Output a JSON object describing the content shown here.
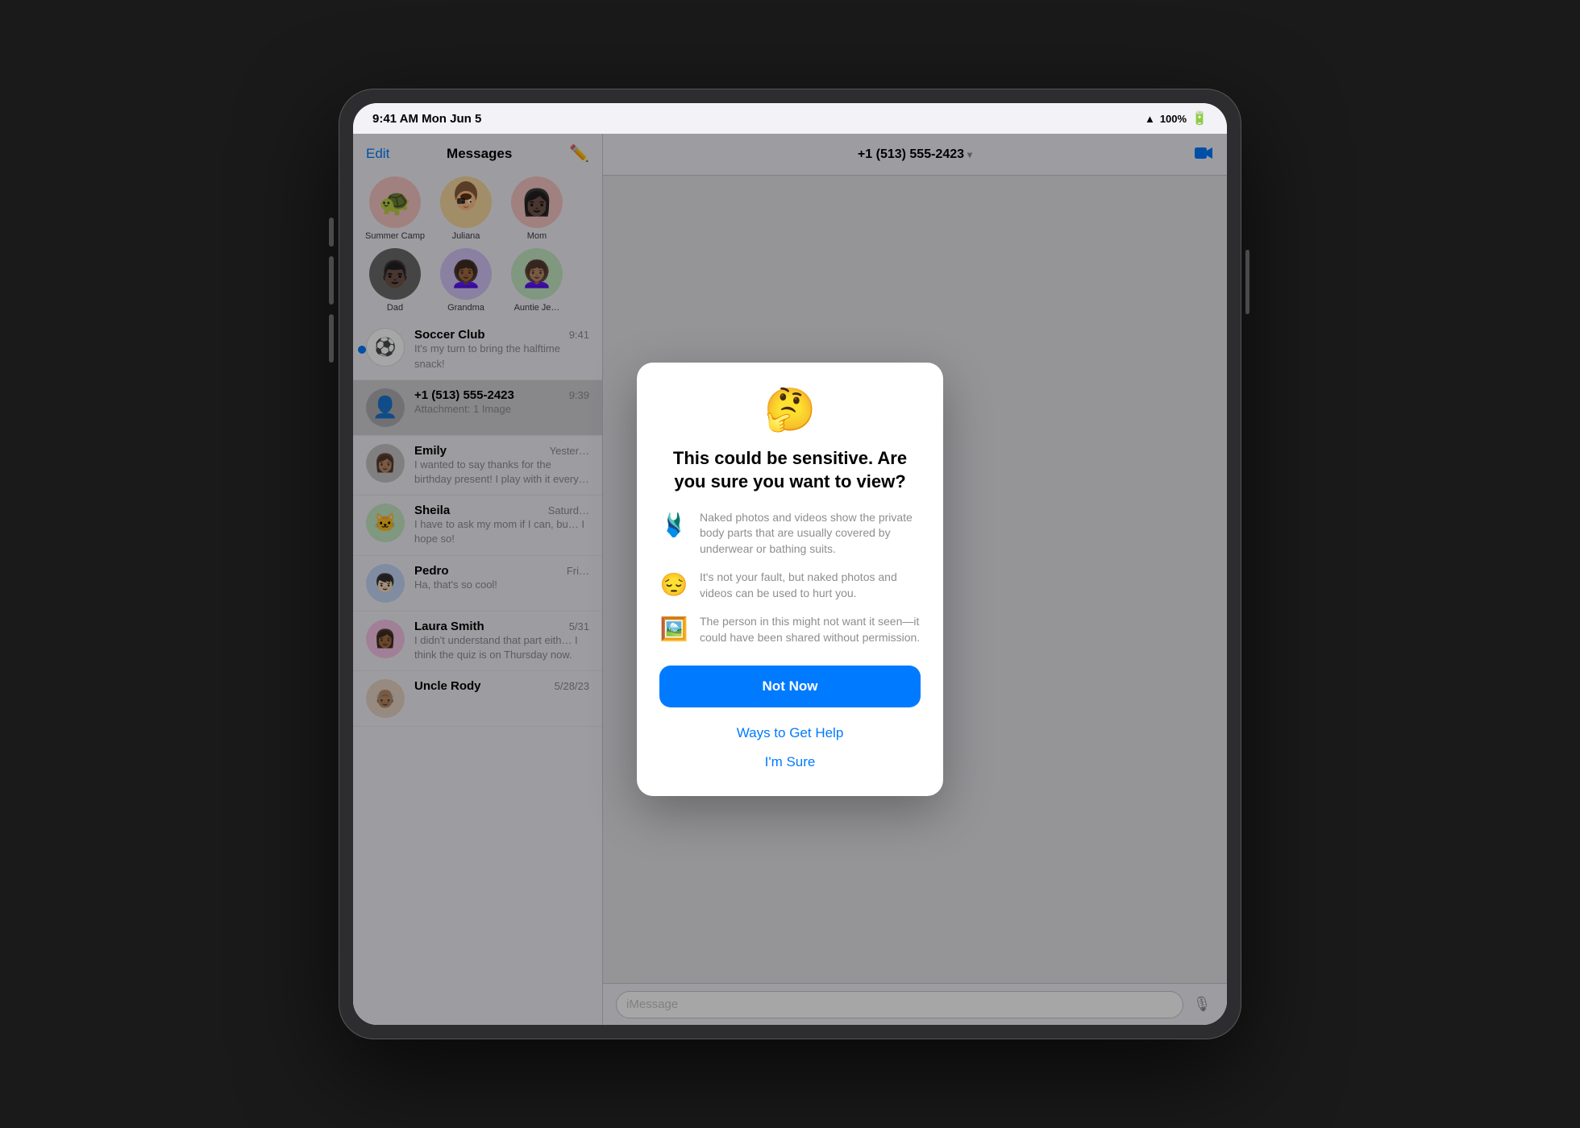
{
  "statusBar": {
    "time": "9:41 AM  Mon Jun 5",
    "wifi": "WiFi",
    "battery": "100%"
  },
  "sidebar": {
    "editLabel": "Edit",
    "title": "Messages"
  },
  "pinnedContacts": [
    {
      "id": "summer-camp",
      "label": "Summer Camp",
      "emoji": "🐢",
      "bg": "avatar-pink"
    },
    {
      "id": "juliana",
      "label": "Juliana",
      "emoji": "👧🏽",
      "bg": "avatar-yellow"
    },
    {
      "id": "mom",
      "label": "Mom",
      "emoji": "👩🏿",
      "bg": "avatar-pink"
    }
  ],
  "pinnedContacts2": [
    {
      "id": "dad",
      "label": "Dad",
      "emoji": "👨🏿",
      "bg": "avatar-dark"
    },
    {
      "id": "grandma",
      "label": "Grandma",
      "emoji": "👩🏾‍🦱",
      "bg": "avatar-purple"
    },
    {
      "id": "auntie",
      "label": "Auntie Je…",
      "emoji": "👩🏽‍🦱",
      "bg": "avatar-green"
    }
  ],
  "messages": [
    {
      "id": "soccer-club",
      "name": "Soccer Club",
      "time": "9:41",
      "preview": "It's my turn to bring the halftime snack!",
      "unread": true,
      "avatar": "⚽",
      "avatarBg": "msg-avatar-soccer"
    },
    {
      "id": "phone-number",
      "name": "+1 (513) 555-2423",
      "time": "9:39",
      "preview": "Attachment: 1 Image",
      "unread": false,
      "avatar": "👤",
      "avatarBg": "msg-avatar-phone",
      "selected": true
    },
    {
      "id": "emily",
      "name": "Emily",
      "time": "Yester…",
      "preview": "I wanted to say thanks for the birthday present! I play with it every day in the yard!",
      "unread": false,
      "avatar": "👩🏽",
      "avatarBg": "msg-avatar-emily"
    },
    {
      "id": "sheila",
      "name": "Sheila",
      "time": "Saturd…",
      "preview": "I have to ask my mom if I can, bu… I hope so!",
      "unread": false,
      "avatar": "🐱",
      "avatarBg": "msg-avatar-sheila"
    },
    {
      "id": "pedro",
      "name": "Pedro",
      "time": "Fri…",
      "preview": "Ha, that's so cool!",
      "unread": false,
      "avatar": "👦🏻",
      "avatarBg": "msg-avatar-pedro"
    },
    {
      "id": "laura-smith",
      "name": "Laura Smith",
      "time": "5/31",
      "preview": "I didn't understand that part eith… I think the quiz is on Thursday now.",
      "unread": false,
      "avatar": "👩🏾",
      "avatarBg": "msg-avatar-laura"
    },
    {
      "id": "uncle-rody",
      "name": "Uncle Rody",
      "time": "5/28/23",
      "preview": "",
      "unread": false,
      "avatar": "👴🏽",
      "avatarBg": "msg-avatar-uncle"
    }
  ],
  "detail": {
    "contact": "+1 (513) 555-2423",
    "inputPlaceholder": "iMessage"
  },
  "dialog": {
    "emoji": "🤔",
    "title": "This could be sensitive. Are you sure you want to view?",
    "items": [
      {
        "icon": "🩱",
        "text": "Naked photos and videos show the private body parts that are usually covered by underwear or bathing suits."
      },
      {
        "icon": "😔",
        "text": "It's not your fault, but naked photos and videos can be used to hurt you."
      },
      {
        "icon": "🖼️",
        "text": "The person in this might not want it seen—it could have been shared without permission."
      }
    ],
    "notNowLabel": "Not Now",
    "waysToHelpLabel": "Ways to Get Help",
    "imSureLabel": "I'm Sure"
  }
}
